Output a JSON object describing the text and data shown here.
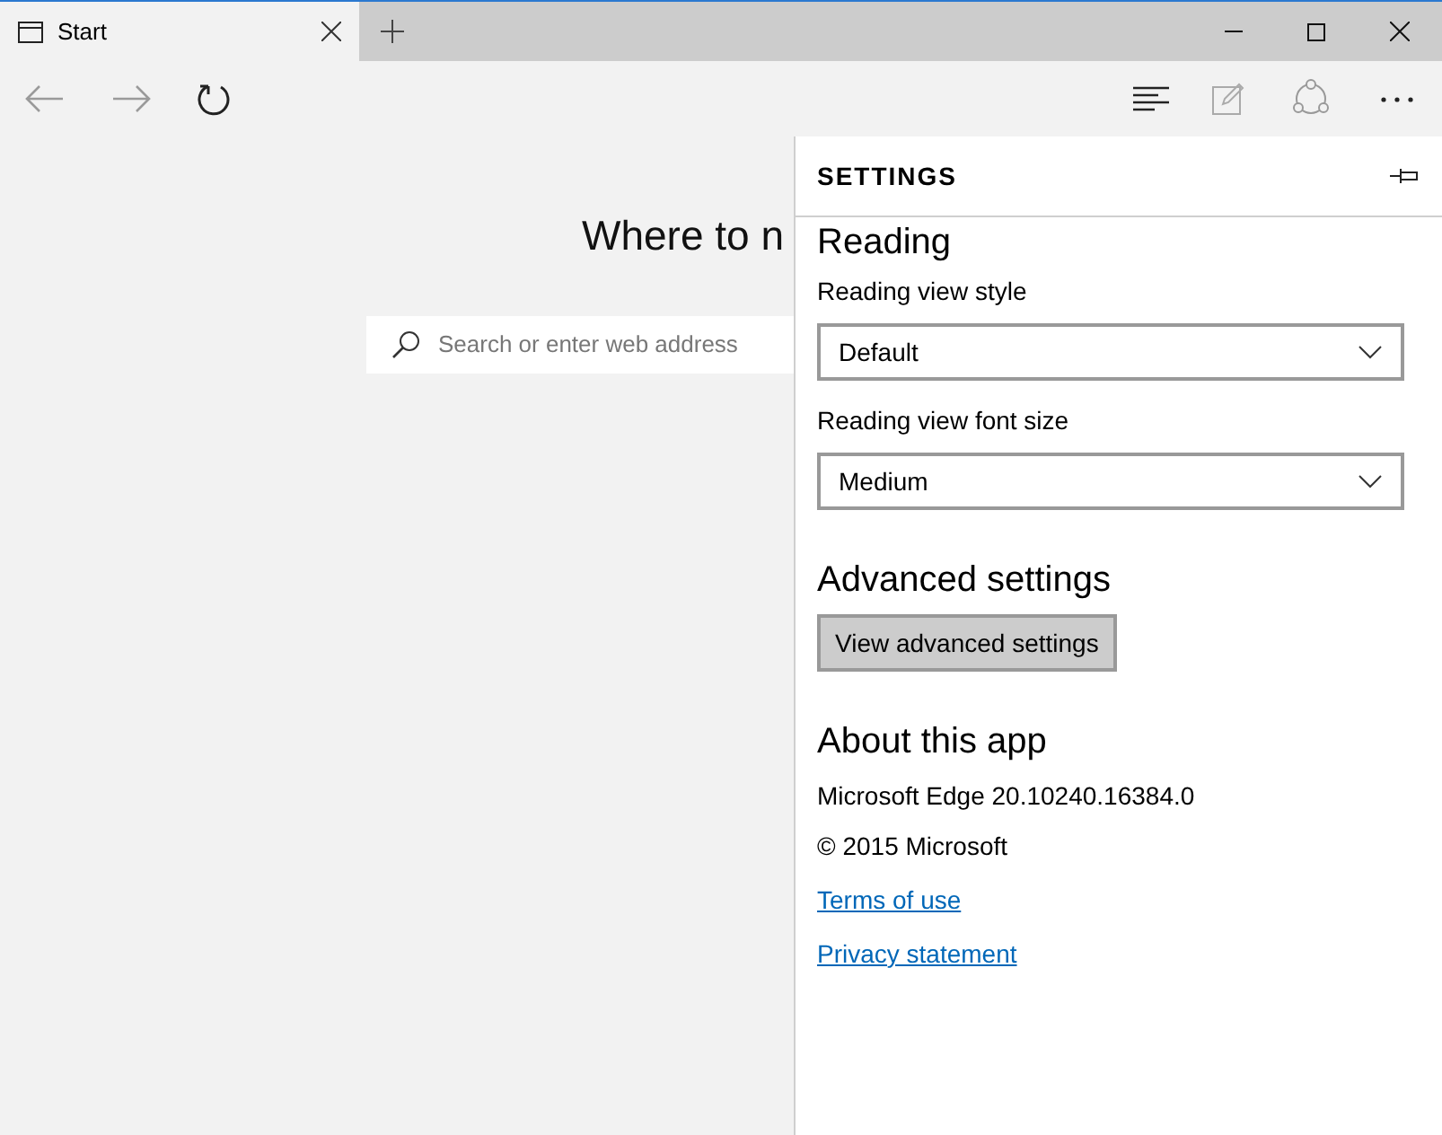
{
  "tabs": [
    {
      "label": "Start",
      "selected": true
    }
  ],
  "toolbar": {
    "back_disabled": true,
    "forward_disabled": true
  },
  "page": {
    "heading": "Where to n",
    "search": {
      "placeholder": "Search or enter web address"
    }
  },
  "settings": {
    "title": "SETTINGS",
    "sections": [
      {
        "kind": "dropdowns",
        "heading": "Reading",
        "fields": [
          {
            "label": "Reading view style",
            "value": "Default"
          },
          {
            "label": "Reading view font size",
            "value": "Medium"
          }
        ]
      },
      {
        "kind": "button",
        "heading": "Advanced settings",
        "button": "View advanced settings"
      },
      {
        "kind": "about",
        "heading": "About this app",
        "lines": [
          "Microsoft Edge 20.10240.16384.0",
          "© 2015 Microsoft"
        ],
        "links": [
          "Terms of use",
          "Privacy statement"
        ]
      }
    ]
  }
}
